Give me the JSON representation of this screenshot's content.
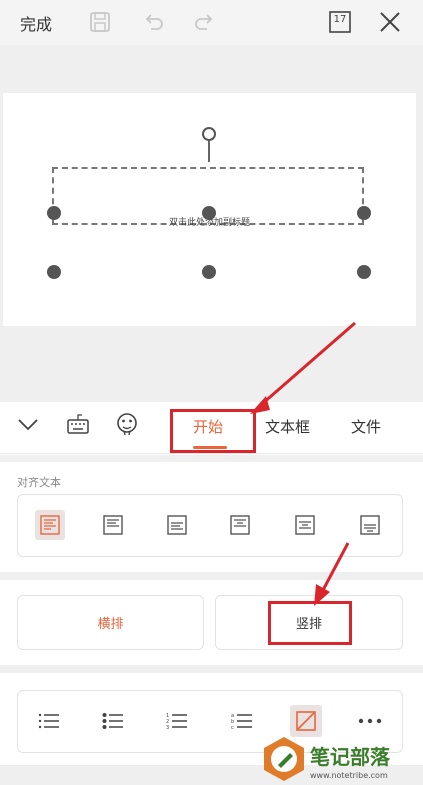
{
  "toolbar": {
    "done_label": "完成",
    "page_count": "17"
  },
  "slide": {
    "placeholder": "双击此处添加副标题"
  },
  "tabs": {
    "start": "开始",
    "textbox": "文本框",
    "file": "文件"
  },
  "align_section": {
    "label": "对齐文本"
  },
  "direction": {
    "horizontal": "横排",
    "vertical": "竖排"
  },
  "watermark": {
    "text": "笔记部落",
    "site": "www.notetribe.com"
  },
  "colors": {
    "accent": "#e8663d",
    "annotation_red": "#d9262c"
  }
}
